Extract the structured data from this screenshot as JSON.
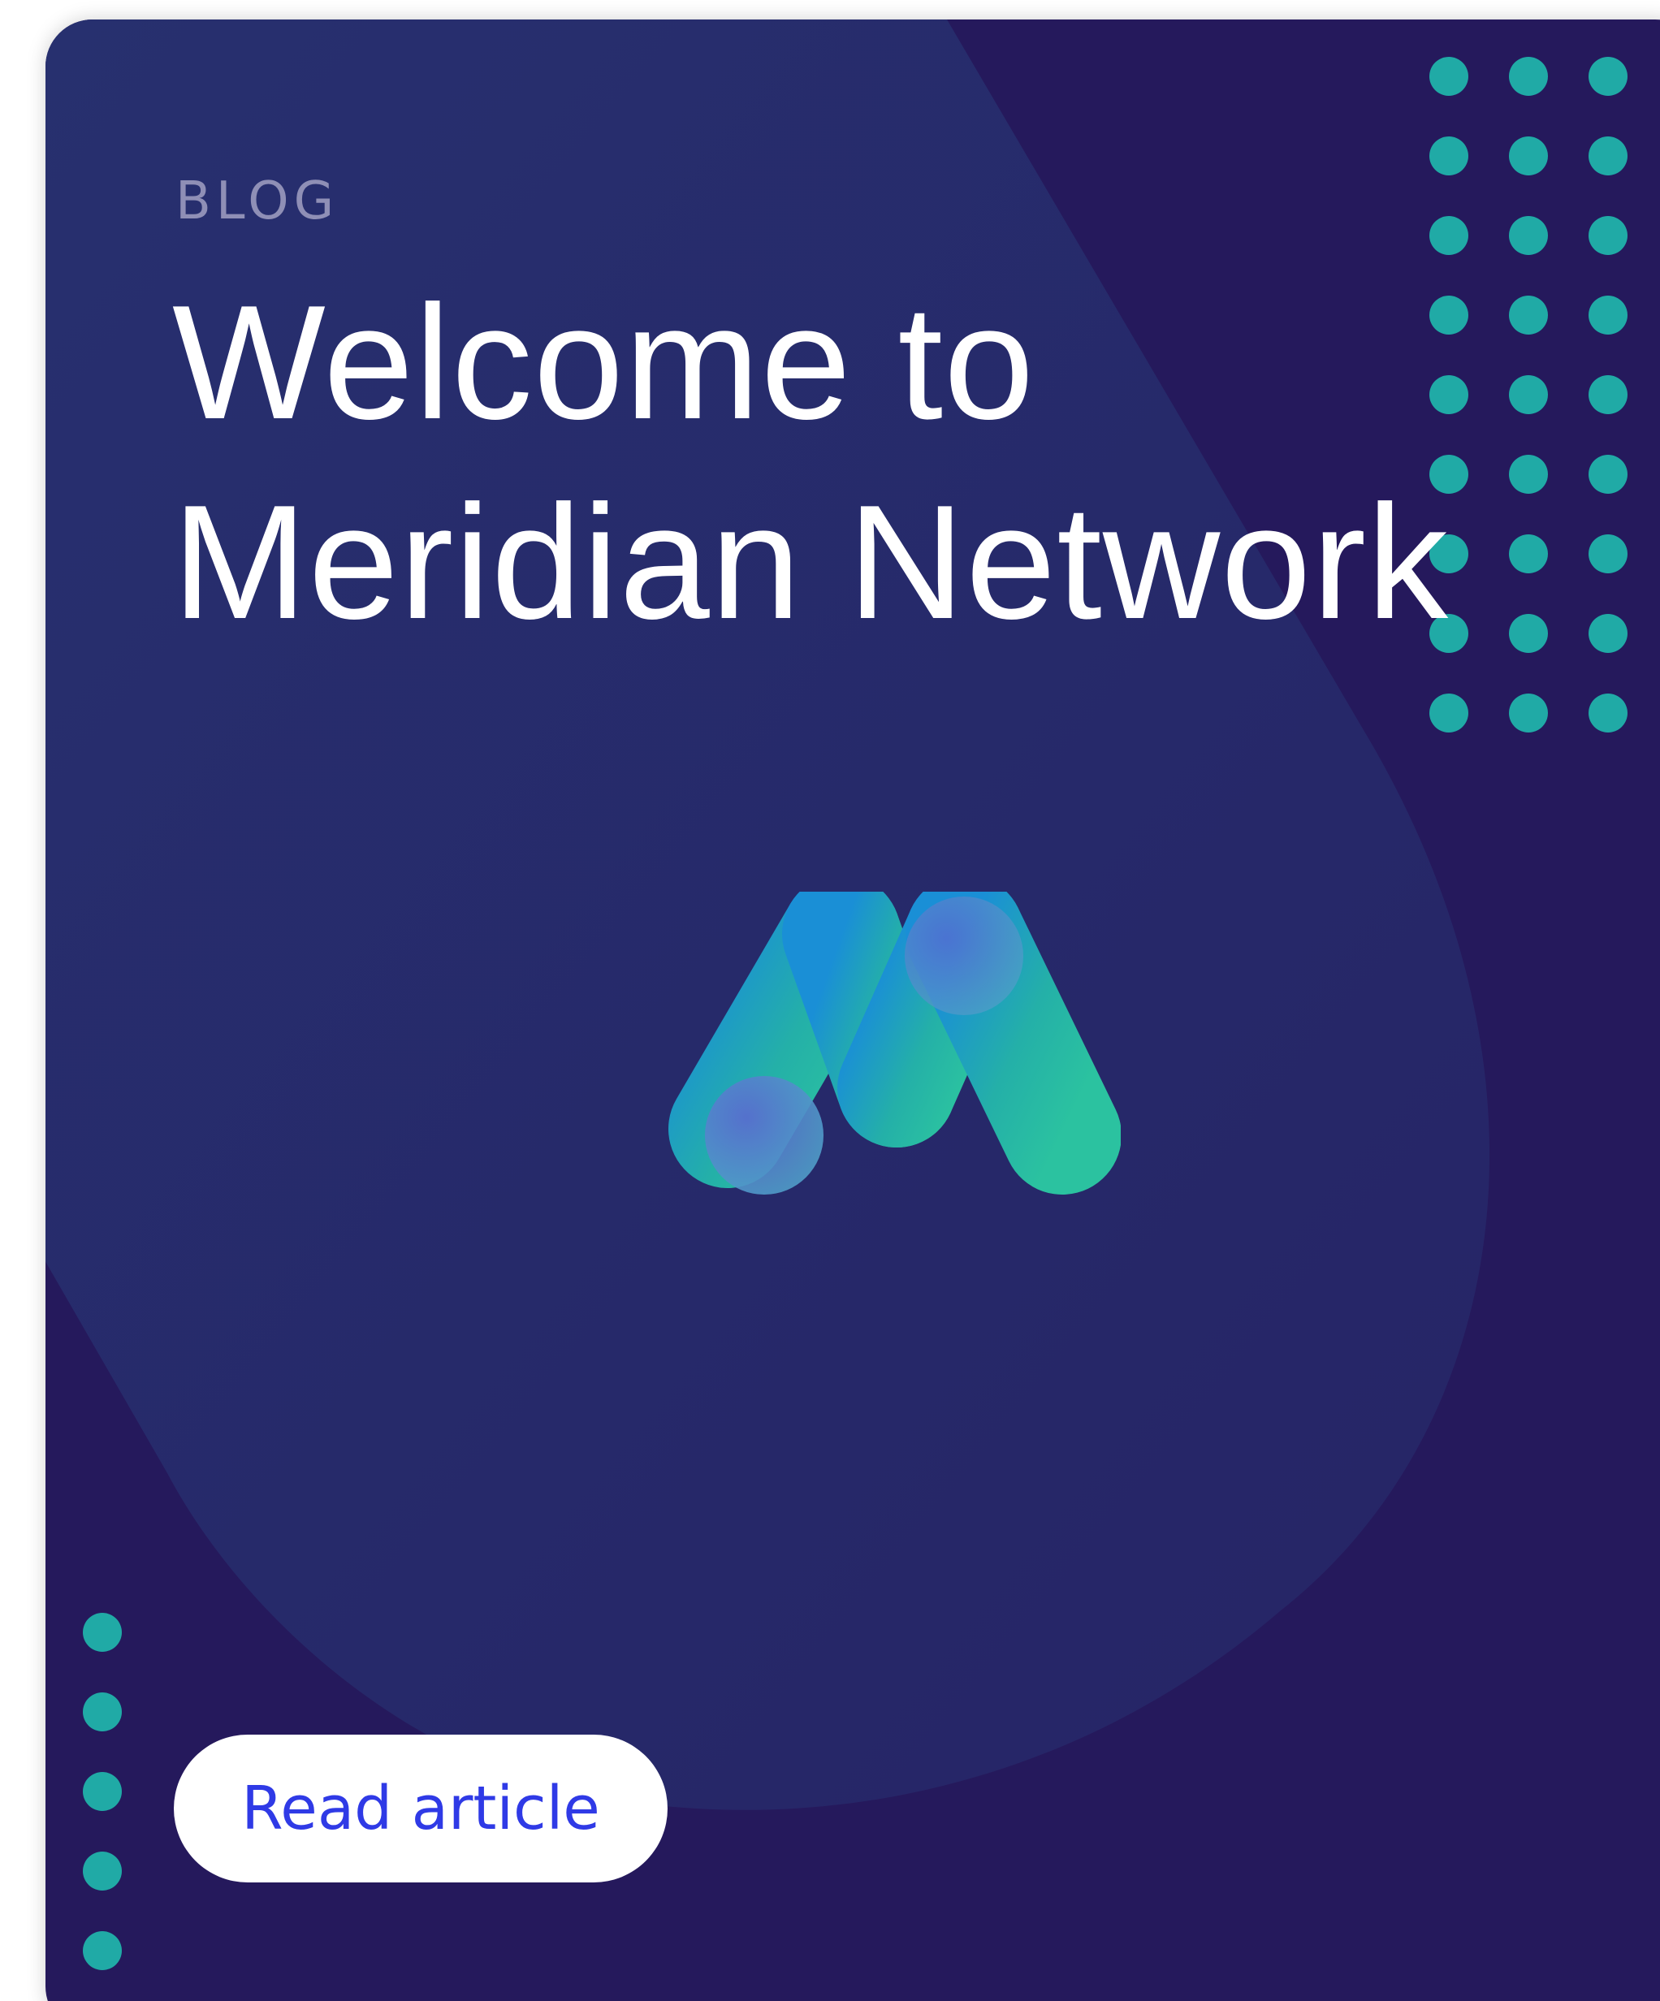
{
  "card": {
    "eyebrow": "BLOG",
    "title_line1": "Welcome to",
    "title_line2": "Meridian Network",
    "cta_label": "Read article",
    "logo_icon": "meridian-m-logo",
    "dot_pattern_icon": "dot-grid-decoration"
  },
  "colors": {
    "card_background": "#25195c",
    "blob": "#262a69",
    "eyebrow_text": "#8f8fb6",
    "title_text": "#ffffff",
    "dot": "#20aaa6",
    "button_background": "#ffffff",
    "button_text": "#2f3ae6",
    "logo_gradient_start": "#1a8fd6",
    "logo_gradient_end": "#2bc2a0",
    "logo_accent": "#6a6fd6"
  }
}
